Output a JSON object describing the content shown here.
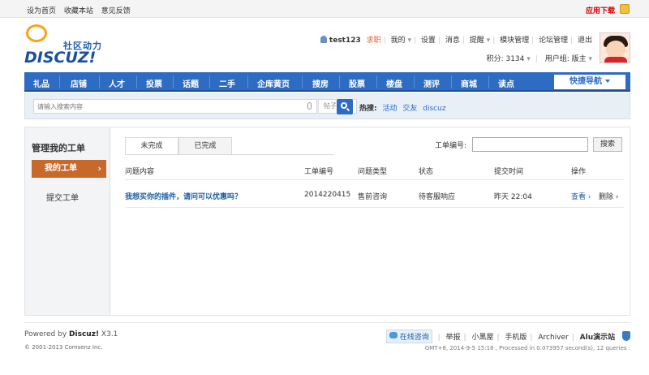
{
  "topbar": {
    "links": [
      "设为首页",
      "收藏本站",
      "意见反馈"
    ],
    "app_download": "应用下载"
  },
  "logo": {
    "slogan": "社区动力",
    "wordmark": "DISCUZ!"
  },
  "user_nav": {
    "username": "test123",
    "seek_help": "求职",
    "mine": "我的",
    "settings": "设置",
    "messages": "消息",
    "reminders": "提醒",
    "module_manage": "模块管理",
    "forum_manage": "论坛管理",
    "logout": "退出"
  },
  "user_info": {
    "points": "积分: 3134",
    "group": "用户组: 版主"
  },
  "main_nav": {
    "items": [
      "礼品",
      "店铺",
      "人才",
      "投票",
      "话题",
      "二手",
      "企库黄页",
      "搜房",
      "股票",
      "楼盘",
      "测评",
      "商城",
      "读点"
    ],
    "quick_nav": "快捷导航"
  },
  "search": {
    "placeholder": "请输入搜索内容",
    "type": "帖子",
    "hot_label": "热搜:",
    "hot_terms": [
      "活动",
      "交友",
      "discuz"
    ]
  },
  "sidebar": {
    "title": "管理我的工单",
    "items": [
      "我的工单",
      "提交工单"
    ]
  },
  "tabs": [
    "未完成",
    "已完成"
  ],
  "order_search": {
    "label": "工单编号:",
    "value": "",
    "button": "搜索"
  },
  "table": {
    "columns": [
      "问题内容",
      "工单编号",
      "问题类型",
      "状态",
      "提交时间",
      "操作"
    ],
    "rows": [
      {
        "subject": "我想买你的插件，请问可以优惠吗？",
        "order_no": "2014220415",
        "type": "售前咨询",
        "status": "待客服响应",
        "time": "昨天 22:04",
        "view": "查看",
        "delete": "删除"
      }
    ]
  },
  "footer": {
    "powered_prefix": "Powered by",
    "powered_brand": "Discuz!",
    "version": "X3.1",
    "copyright": "© 2001-2013 Comsenz Inc.",
    "online_chat": "在线咨询",
    "links": [
      "举报",
      "小黑屋",
      "手机版",
      "Archiver"
    ],
    "site": "Alu演示站",
    "gmt": "GMT+8, 2014-9-5 15:18 , Processed in 0.073957 second(s), 12 queries ."
  }
}
